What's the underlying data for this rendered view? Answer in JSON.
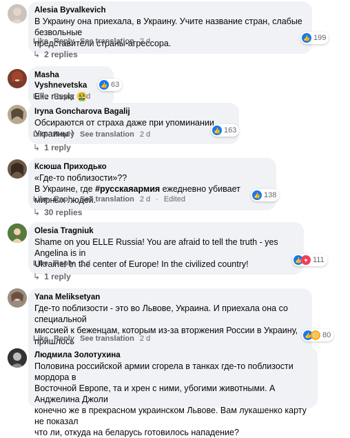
{
  "actions": {
    "like": "Like",
    "reply": "Reply",
    "see_translation": "See translation",
    "edited": "Edited"
  },
  "comments": [
    {
      "author": "Alesia Byvalkevich",
      "text": "В Украину она приехала, в Украину. Учите название стран, слабые безвольные\nпредставители страны-агрессора.",
      "time": "2 d",
      "reaction_count": "199",
      "reactions": [
        "like-icon"
      ],
      "replies": "2 replies"
    },
    {
      "author": "Masha Vyshnevetska",
      "text": "Elle russia 🤮",
      "time": "2 d",
      "reaction_count": "63",
      "reactions": [
        "like-icon"
      ]
    },
    {
      "author": "Iryna Goncharova Bagalij",
      "text": "Обсираются от страха даже при упоминании Украины )",
      "time": "2 d",
      "reaction_count": "163",
      "reactions": [
        "like-icon"
      ],
      "replies": "1 reply"
    },
    {
      "author": "Ксюша Приходько",
      "line1": "«Где-то поблизости»??",
      "line2_pre": "В Украине, где ",
      "hashtag": "#русскаяармия",
      "line2_post": " ежедневно убивает мирных людей.",
      "time": "2 d",
      "edited": "Edited",
      "reaction_count": "138",
      "reactions": [
        "like-icon"
      ],
      "replies": "30 replies"
    },
    {
      "author": "Olesia Tragniuk",
      "text": "Shame on you ELLE Russia! You are afraid to tell the truth - yes Angelina is in\nUkraine! In the center of Europe! In the civilized country!",
      "time": "2 d",
      "reaction_count": "111",
      "reactions": [
        "like-icon",
        "love-icon"
      ],
      "replies": "1 reply"
    },
    {
      "author": "Yana Meliksetyan",
      "text": "Где-то поблизости - это во Львове, Украина. И приехала она со специальной\nмиссией к беженцам, которым из-за вторжения России в Украину, пришлось\nоставить свои дома и бежать на Западную Украину.",
      "time": "2 d",
      "reaction_count": "80",
      "reactions": [
        "like-icon",
        "sad-icon"
      ]
    },
    {
      "author": "Людмила Золотухина",
      "text": "Половина российской армии сгорела в танках где-то поблизости мордора в\nВосточной Европе, та и хрен с ними, убогими животными. А Анджелина Джоли\nконечно же в прекрасном украинском Львове. Вам лукашенко карту не показал\nчто ли, откуда на беларусь готовилось нападение?"
    }
  ]
}
